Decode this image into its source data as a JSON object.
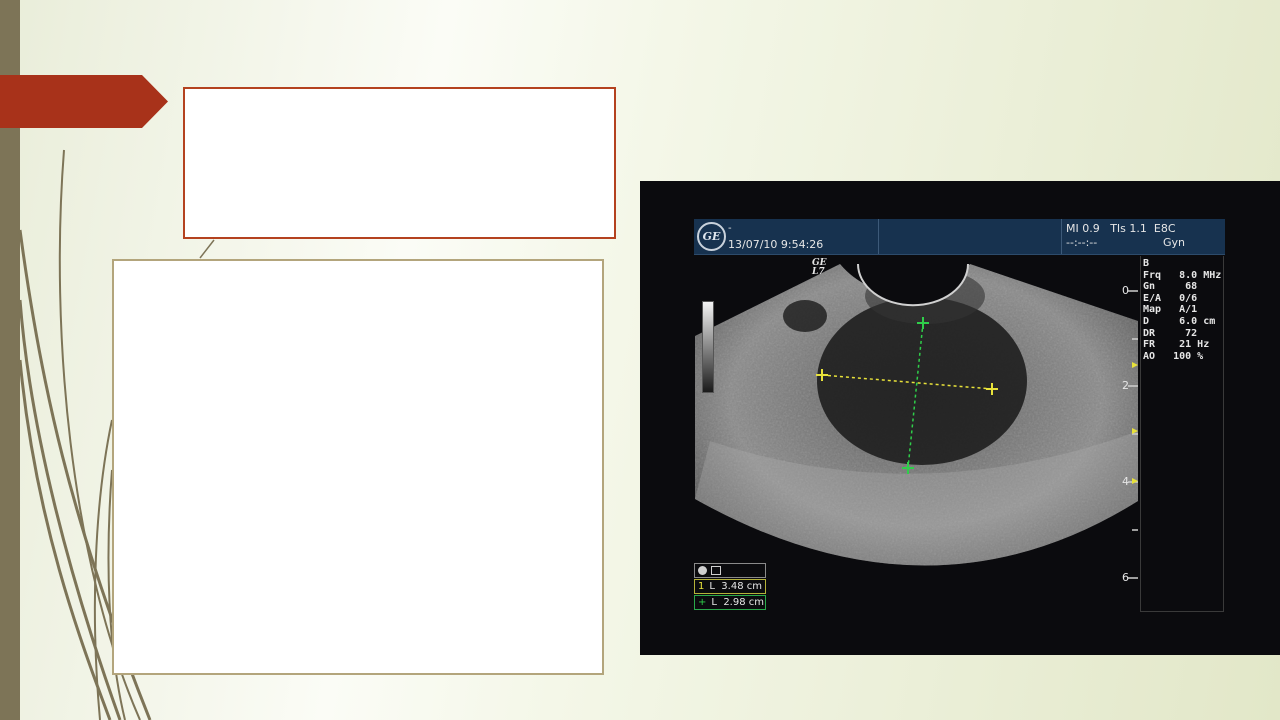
{
  "slide": {
    "title_box": {
      "text": ""
    },
    "content_box": {
      "text": ""
    }
  },
  "ultrasound": {
    "logo": "GE",
    "header": {
      "dash": "-",
      "datetime": "13/07/10 9:54:26",
      "mi_tis": "MI 0.9   TIs 1.1  E8C",
      "dashes": "--:--:--",
      "preset": "Gyn"
    },
    "probe_mark": "GE\nL7",
    "params": [
      "B",
      "Frq   8.0 MHz",
      "Gn     68",
      "E/A   0/6",
      "Map   A/1",
      "D     6.0 cm",
      "DR     72",
      "FR    21 Hz",
      "AO   100 %"
    ],
    "depth_labels": [
      "0",
      "2",
      "4",
      "6"
    ],
    "measurements": {
      "header": "",
      "row1": {
        "marker": "1",
        "text": "L  3.48 cm"
      },
      "row2": {
        "marker": "+",
        "text": "L  2.98 cm"
      }
    },
    "colors": {
      "caliper_1": "#e8e23a",
      "caliper_2": "#2fcf4a",
      "header_bg": "#17324f"
    }
  },
  "theme": {
    "accent": "#a8321a",
    "left_bar": "#7d7457",
    "content_border": "#b3a57c"
  }
}
